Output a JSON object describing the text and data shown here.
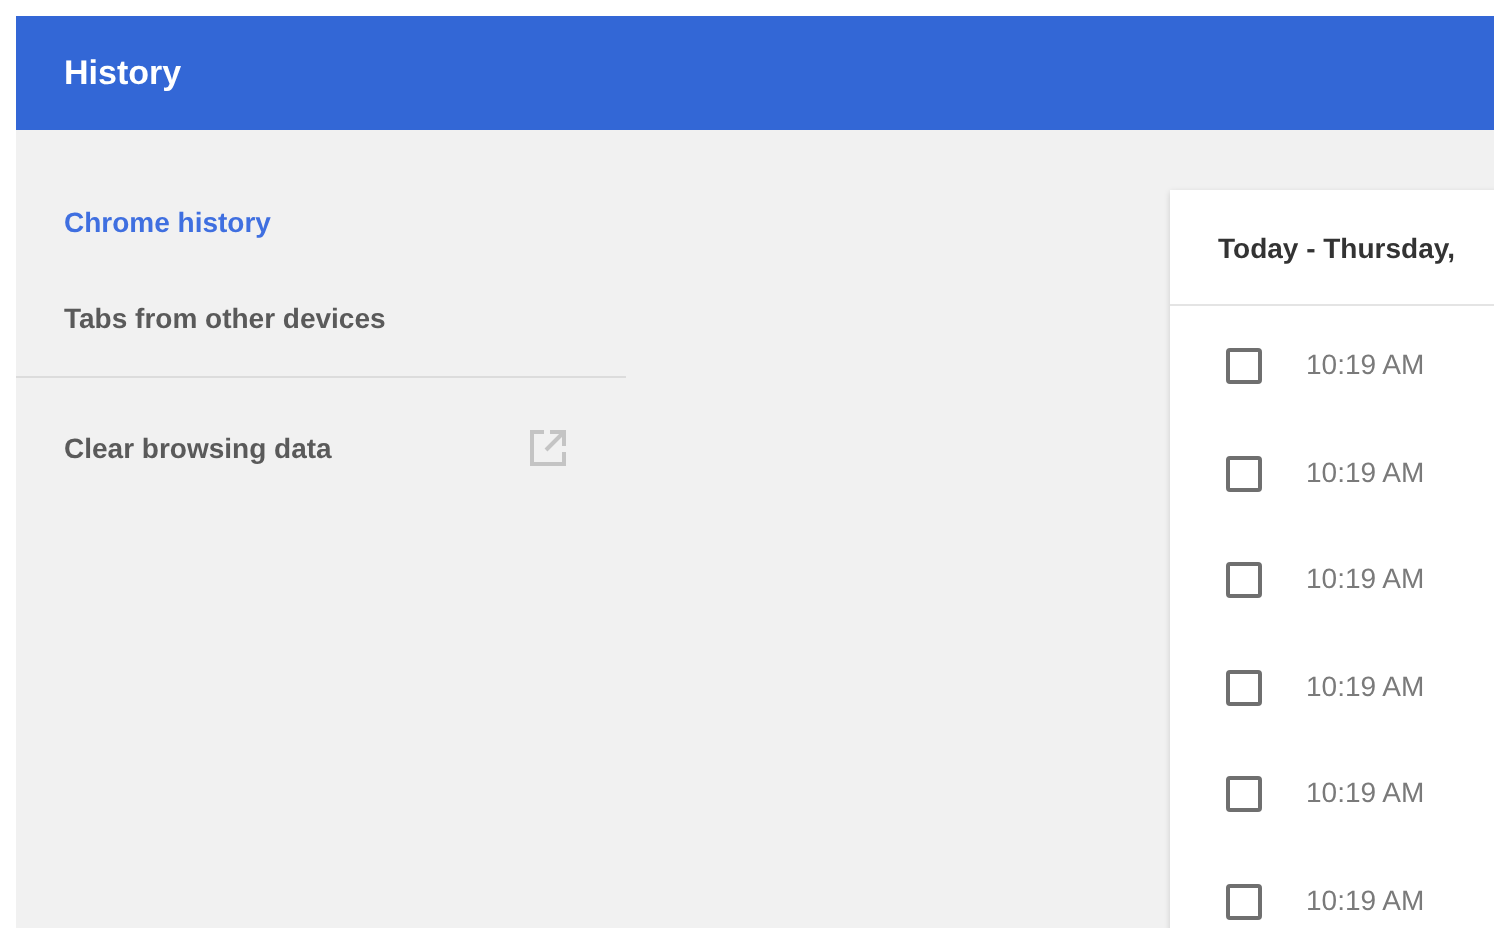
{
  "toolbar": {
    "title": "History"
  },
  "sidebar": {
    "items": [
      {
        "label": "Chrome history",
        "selected": true
      },
      {
        "label": "Tabs from other devices",
        "selected": false
      }
    ],
    "footer_link": {
      "label": "Clear browsing data"
    }
  },
  "history_card": {
    "heading": "Today - Thursday,",
    "entries": [
      {
        "time": "10:19 AM",
        "checked": false
      },
      {
        "time": "10:19 AM",
        "checked": false
      },
      {
        "time": "10:19 AM",
        "checked": false
      },
      {
        "time": "10:19 AM",
        "checked": false
      },
      {
        "time": "10:19 AM",
        "checked": false
      },
      {
        "time": "10:19 AM",
        "checked": false
      }
    ]
  }
}
